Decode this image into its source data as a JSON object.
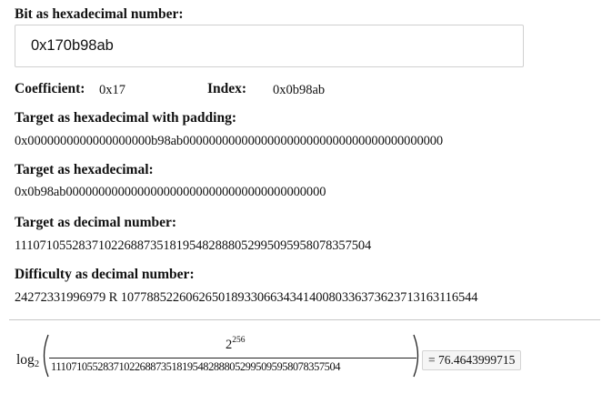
{
  "bits_label": "Bit as hexadecimal number:",
  "bits_value": "0x170b98ab",
  "coefficient_label": "Coefficient:",
  "coefficient_value": "0x17",
  "index_label": "Index:",
  "index_value": "0x0b98ab",
  "target_padded_label": "Target as hexadecimal with padding:",
  "target_padded_value": "0x0000000000000000000b98ab0000000000000000000000000000000000000000",
  "target_hex_label": "Target as hexadecimal:",
  "target_hex_value": "0x0b98ab0000000000000000000000000000000000000000",
  "target_decimal_label": "Target as decimal number:",
  "target_decimal_value": "111071055283710226887351819548288805299509595807835750­4",
  "difficulty_label": "Difficulty as decimal number:",
  "difficulty_value": "24272331996979 R 10778852260626501893306634341400803363736237131631165­44",
  "formula": {
    "log_text": "log",
    "log_base": "2",
    "numerator_base": "2",
    "numerator_exponent": "256",
    "denominator": "1110710552837102268873518195482888052995095958078357504",
    "equals_result": "= 76.4643999715"
  }
}
